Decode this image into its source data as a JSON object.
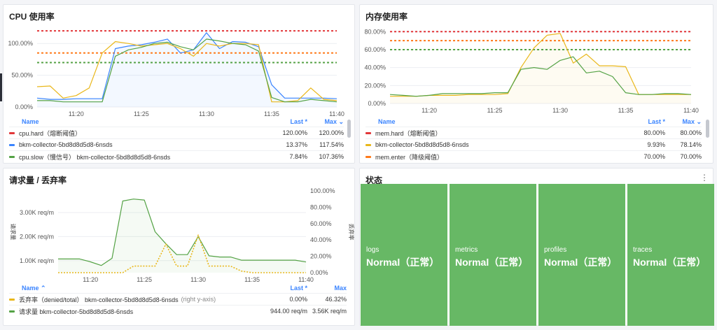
{
  "cpu": {
    "title": "CPU 使用率",
    "legend": {
      "col_name": "Name",
      "col_last": "Last *",
      "col_max": "Max ⌄",
      "rows": [
        {
          "name": "cpu.hard（熔断阈值）",
          "color": "#e2373a",
          "last": "120.00%",
          "max": "120.00%"
        },
        {
          "name": "bkm-collector-5bd8d8d5d8-6nsds",
          "color": "#3a84ff",
          "last": "13.37%",
          "max": "117.54%"
        },
        {
          "name": "cpu.slow（慢信号） bkm-collector-5bd8d8d5d8-6nsds",
          "color": "#54a245",
          "last": "7.84%",
          "max": "107.36%"
        }
      ]
    }
  },
  "mem": {
    "title": "内存使用率",
    "legend": {
      "col_name": "Name",
      "col_last": "Last *",
      "col_max": "Max ⌄",
      "rows": [
        {
          "name": "mem.hard（熔断阈值）",
          "color": "#e2373a",
          "last": "80.00%",
          "max": "80.00%"
        },
        {
          "name": "bkm-collector-5bd8d8d5d8-6nsds",
          "color": "#e9b71a",
          "last": "9.93%",
          "max": "78.14%"
        },
        {
          "name": "mem.enter（降级阈值）",
          "color": "#ff7a1a",
          "last": "70.00%",
          "max": "70.00%"
        }
      ]
    }
  },
  "req": {
    "title": "请求量 / 丢弃率",
    "ylabel_left": "请求量",
    "ylabel_right": "丢弃率",
    "legend": {
      "col_name": "Name ⌃",
      "col_last": "Last *",
      "col_max": "Max",
      "rows": [
        {
          "name": "丢弃率（denied/total） bkm-collector-5bd8d8d5d8-6nsds",
          "suffix": "(right y-axis)",
          "color": "#e9b71a",
          "last": "0.00%",
          "max": "46.32%"
        },
        {
          "name": "请求量 bkm-collector-5bd8d8d5d8-6nsds",
          "suffix": "",
          "color": "#54a245",
          "last": "944.00 req/m",
          "max": "3.56K req/m"
        }
      ]
    }
  },
  "status": {
    "title": "状态",
    "menu_icon": "more-vertical-icon",
    "tiles": [
      {
        "label": "logs",
        "value": "Normal（正常）"
      },
      {
        "label": "metrics",
        "value": "Normal（正常）"
      },
      {
        "label": "profiles",
        "value": "Normal（正常）"
      },
      {
        "label": "traces",
        "value": "Normal（正常）"
      }
    ],
    "tile_color": "#67b865"
  },
  "chart_data": [
    {
      "type": "line",
      "title": "CPU 使用率",
      "x": [
        "11:17",
        "11:18",
        "11:19",
        "11:20",
        "11:21",
        "11:22",
        "11:23",
        "11:24",
        "11:25",
        "11:26",
        "11:27",
        "11:28",
        "11:29",
        "11:30",
        "11:31",
        "11:32",
        "11:33",
        "11:34",
        "11:35",
        "11:36",
        "11:37",
        "11:38",
        "11:39",
        "11:40"
      ],
      "xticks": [
        "11:20",
        "11:25",
        "11:30",
        "11:35",
        "11:40"
      ],
      "yticks": [
        "0.00%",
        "50.00%",
        "100.00%"
      ],
      "ylim": [
        0,
        130
      ],
      "series": [
        {
          "name": "cpu.hard（熔断阈值）",
          "color": "#e2373a",
          "style": "dashed",
          "values": [
            120,
            120,
            120,
            120,
            120,
            120,
            120,
            120,
            120,
            120,
            120,
            120,
            120,
            120,
            120,
            120,
            120,
            120,
            120,
            120,
            120,
            120,
            120,
            120
          ]
        },
        {
          "name": "",
          "color": "#ff7a1a",
          "style": "dashed",
          "values": [
            85,
            85,
            85,
            85,
            85,
            85,
            85,
            85,
            85,
            85,
            85,
            85,
            85,
            85,
            85,
            85,
            85,
            85,
            85,
            85,
            85,
            85,
            85,
            85
          ]
        },
        {
          "name": "",
          "color": "#54a245",
          "style": "dashed",
          "values": [
            70,
            70,
            70,
            70,
            70,
            70,
            70,
            70,
            70,
            70,
            70,
            70,
            70,
            70,
            70,
            70,
            70,
            70,
            70,
            70,
            70,
            70,
            70,
            70
          ]
        },
        {
          "name": "bkm-collector-5bd8d8d5d8-6nsds",
          "color": "#3a84ff",
          "values": [
            14,
            12,
            12,
            13,
            13,
            13,
            92,
            96,
            98,
            102,
            107,
            85,
            90,
            117,
            92,
            103,
            102,
            95,
            35,
            14,
            14,
            14,
            14,
            13
          ]
        },
        {
          "name": "",
          "color": "#e9b71a",
          "values": [
            32,
            33,
            14,
            18,
            30,
            85,
            103,
            100,
            96,
            98,
            100,
            92,
            80,
            100,
            96,
            100,
            100,
            98,
            8,
            8,
            10,
            30,
            12,
            10
          ]
        },
        {
          "name": "cpu.slow（慢信号） bkm-collector-5bd8d8d5d8-6nsds",
          "color": "#54a245",
          "values": [
            10,
            10,
            8,
            8,
            8,
            8,
            80,
            90,
            94,
            100,
            102,
            95,
            90,
            107,
            104,
            100,
            98,
            88,
            15,
            8,
            8,
            12,
            10,
            8
          ]
        }
      ]
    },
    {
      "type": "line",
      "title": "内存使用率",
      "x": [
        "11:17",
        "11:18",
        "11:19",
        "11:20",
        "11:21",
        "11:22",
        "11:23",
        "11:24",
        "11:25",
        "11:26",
        "11:27",
        "11:28",
        "11:29",
        "11:30",
        "11:31",
        "11:32",
        "11:33",
        "11:34",
        "11:35",
        "11:36",
        "11:37",
        "11:38",
        "11:39",
        "11:40"
      ],
      "xticks": [
        "11:20",
        "11:25",
        "11:30",
        "11:35",
        "11:40"
      ],
      "yticks": [
        "0.00%",
        "20.00%",
        "40.00%",
        "60.00%",
        "80.00%"
      ],
      "ylim": [
        0,
        88
      ],
      "series": [
        {
          "name": "mem.hard（熔断阈值）",
          "color": "#e2373a",
          "style": "dashed",
          "values": [
            80,
            80,
            80,
            80,
            80,
            80,
            80,
            80,
            80,
            80,
            80,
            80,
            80,
            80,
            80,
            80,
            80,
            80,
            80,
            80,
            80,
            80,
            80,
            80
          ]
        },
        {
          "name": "mem.enter（降级阈值）",
          "color": "#ff7a1a",
          "style": "dashed",
          "values": [
            70,
            70,
            70,
            70,
            70,
            70,
            70,
            70,
            70,
            70,
            70,
            70,
            70,
            70,
            70,
            70,
            70,
            70,
            70,
            70,
            70,
            70,
            70,
            70
          ]
        },
        {
          "name": "",
          "color": "#54a245",
          "style": "dashed",
          "values": [
            60,
            60,
            60,
            60,
            60,
            60,
            60,
            60,
            60,
            60,
            60,
            60,
            60,
            60,
            60,
            60,
            60,
            60,
            60,
            60,
            60,
            60,
            60,
            60
          ]
        },
        {
          "name": "bkm-collector-5bd8d8d5d8-6nsds",
          "color": "#e9b71a",
          "values": [
            8,
            8,
            8,
            9,
            9,
            9,
            10,
            10,
            10,
            11,
            40,
            62,
            76,
            78,
            45,
            55,
            42,
            42,
            41,
            10,
            10,
            10,
            10,
            10
          ]
        },
        {
          "name": "",
          "color": "#54a245",
          "values": [
            10,
            9,
            8,
            9,
            11,
            11,
            11,
            11,
            12,
            12,
            38,
            40,
            38,
            48,
            52,
            34,
            36,
            30,
            12,
            10,
            10,
            11,
            11,
            10
          ]
        }
      ]
    },
    {
      "type": "line",
      "title": "请求量 / 丢弃率",
      "x": [
        "11:17",
        "11:18",
        "11:19",
        "11:20",
        "11:21",
        "11:22",
        "11:23",
        "11:24",
        "11:25",
        "11:26",
        "11:27",
        "11:28",
        "11:29",
        "11:30",
        "11:31",
        "11:32",
        "11:33",
        "11:34",
        "11:35",
        "11:36",
        "11:37",
        "11:38",
        "11:39",
        "11:40"
      ],
      "xticks": [
        "11:20",
        "11:25",
        "11:30",
        "11:35",
        "11:40"
      ],
      "ylabel": "请求量",
      "ylabel_right": "丢弃率",
      "yticks": [
        "1.00K req/m",
        "2.00K req/m",
        "3.00K req/m"
      ],
      "yticks_right": [
        "0.00%",
        "20.00%",
        "40.00%",
        "60.00%",
        "80.00%",
        "100.00%"
      ],
      "ylim": [
        500,
        3900
      ],
      "ylim_right": [
        0,
        100
      ],
      "series": [
        {
          "name": "请求量 bkm-collector-5bd8d8d5d8-6nsds",
          "color": "#54a245",
          "axis": "left",
          "values": [
            1070,
            1070,
            1070,
            950,
            800,
            1100,
            3480,
            3560,
            3520,
            2200,
            1700,
            1250,
            1250,
            2000,
            1200,
            1150,
            1150,
            1020,
            1020,
            1020,
            1020,
            1020,
            1020,
            944
          ]
        },
        {
          "name": "丢弃率（denied/total） bkm-collector-5bd8d8d5d8-6nsds",
          "color": "#e9b71a",
          "axis": "right",
          "style": "dotted",
          "values": [
            0,
            0,
            0,
            0,
            0,
            0,
            0,
            8,
            8,
            8,
            35,
            8,
            8,
            46,
            8,
            8,
            8,
            2,
            0,
            0,
            0,
            0,
            0,
            0
          ]
        }
      ]
    }
  ]
}
